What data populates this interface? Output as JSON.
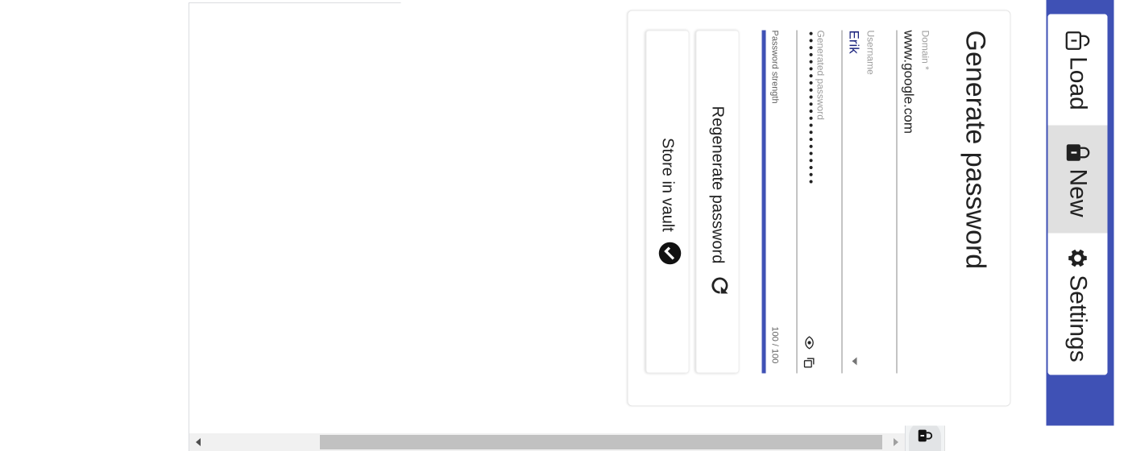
{
  "tabs": [
    {
      "label": "Load",
      "icon": "lock-open-icon",
      "selected": false
    },
    {
      "label": "New",
      "icon": "lock-icon",
      "selected": true
    },
    {
      "label": "Settings",
      "icon": "gear-icon",
      "selected": false
    }
  ],
  "form": {
    "title": "Generate password",
    "domain_label": "Domain *",
    "domain_value": "www.google.com",
    "username_label": "Username",
    "username_value": "Erik",
    "password_label": "Generated password",
    "password_value": "••••••••••••••••••••••",
    "strength_label": "Password strength",
    "strength_count": "100 / 100",
    "strength_fraction": 1.0,
    "regenerate_label": "Regenerate password",
    "store_label": "Store in vault"
  },
  "colors": {
    "primary": "#3f51b5",
    "selected_tab": "#e0e0e0"
  }
}
